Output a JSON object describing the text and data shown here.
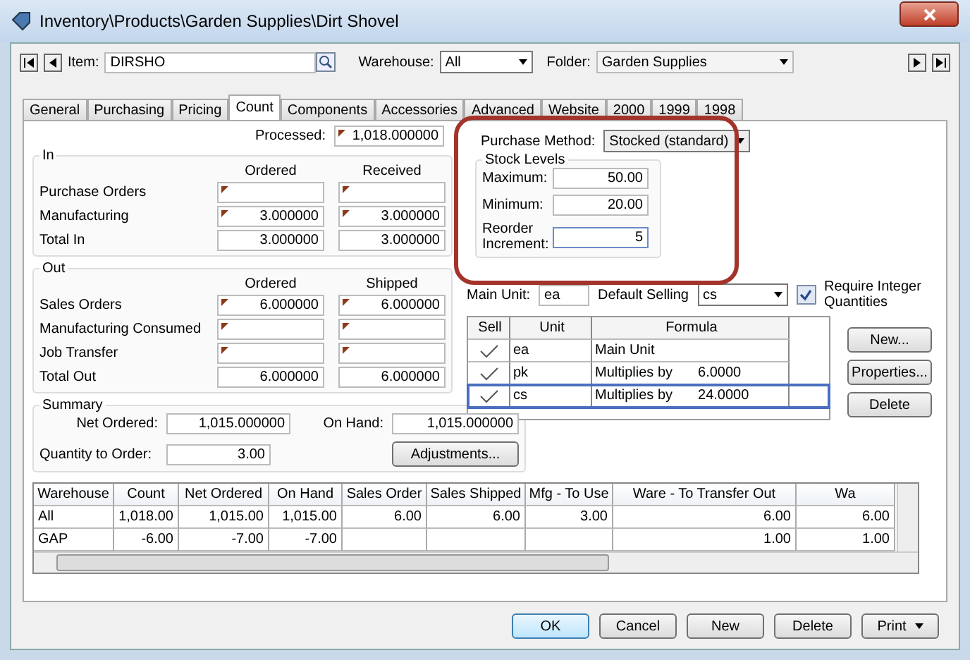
{
  "window": {
    "title": "Inventory\\Products\\Garden Supplies\\Dirt Shovel"
  },
  "toolbar": {
    "item_label": "Item:",
    "item_value": "DIRSHO",
    "warehouse_label": "Warehouse:",
    "warehouse_value": "All",
    "folder_label": "Folder:",
    "folder_value": "Garden Supplies"
  },
  "tabs": [
    {
      "label": "General",
      "selected": false
    },
    {
      "label": "Purchasing",
      "selected": false
    },
    {
      "label": "Pricing",
      "selected": false
    },
    {
      "label": "Count",
      "selected": true
    },
    {
      "label": "Components",
      "selected": false
    },
    {
      "label": "Accessories",
      "selected": false
    },
    {
      "label": "Advanced",
      "selected": false
    },
    {
      "label": "Website",
      "selected": false
    },
    {
      "label": "2000",
      "selected": false
    },
    {
      "label": "1999",
      "selected": false
    },
    {
      "label": "1998",
      "selected": false
    }
  ],
  "processed": {
    "label": "Processed:",
    "value": "1,018.000000",
    "flagged": true
  },
  "in_group": {
    "title": "In",
    "columns": [
      "Ordered",
      "Received"
    ],
    "rows": [
      {
        "label": "Purchase Orders",
        "cells": [
          {
            "flagged": true
          },
          {
            "flagged": true
          }
        ]
      },
      {
        "label": "Manufacturing",
        "cells": [
          {
            "value": "3.000000",
            "flagged": true
          },
          {
            "value": "3.000000",
            "flagged": true
          }
        ]
      },
      {
        "label": "Total In",
        "cells": [
          {
            "value": "3.000000",
            "flagged": false
          },
          {
            "value": "3.000000",
            "flagged": false
          }
        ]
      }
    ]
  },
  "out_group": {
    "title": "Out",
    "columns": [
      "Ordered",
      "Shipped"
    ],
    "rows": [
      {
        "label": "Sales Orders",
        "cells": [
          {
            "value": "6.000000",
            "flagged": true
          },
          {
            "value": "6.000000",
            "flagged": true
          }
        ]
      },
      {
        "label": "Manufacturing Consumed",
        "cells": [
          {
            "flagged": true
          },
          {
            "flagged": true
          }
        ]
      },
      {
        "label": "Job Transfer",
        "cells": [
          {
            "flagged": true
          },
          {
            "flagged": true
          }
        ]
      },
      {
        "label": "Total Out",
        "cells": [
          {
            "value": "6.000000",
            "flagged": false
          },
          {
            "value": "6.000000",
            "flagged": false
          }
        ]
      }
    ]
  },
  "summary": {
    "title": "Summary",
    "net_ordered_label": "Net Ordered:",
    "net_ordered": "1,015.000000",
    "on_hand_label": "On Hand:",
    "on_hand": "1,015.000000",
    "quantity_label": "Quantity to Order:",
    "quantity": "3.00",
    "adjustments_button": "Adjustments..."
  },
  "purchase_method": {
    "label": "Purchase Method:",
    "value": "Stocked (standard)"
  },
  "stock_levels": {
    "title": "Stock Levels",
    "rows": [
      {
        "label": "Maximum:",
        "value": "50.00",
        "focused": false
      },
      {
        "label": "Minimum:",
        "value": "20.00",
        "focused": false
      },
      {
        "label": "Reorder Increment:",
        "value": "5",
        "focused": true
      }
    ]
  },
  "units": {
    "main_unit_label": "Main Unit:",
    "main_unit_value": "ea",
    "default_selling_label": "Default Selling",
    "default_selling_value": "cs",
    "require_integer": {
      "label": "Require Integer Quantities",
      "checked": true
    },
    "columns": [
      "Sell",
      "Unit",
      "Formula"
    ],
    "rows": [
      {
        "sell": true,
        "unit": "ea",
        "formula": "Main Unit",
        "selected": false
      },
      {
        "sell": true,
        "unit": "pk",
        "formula": "Multiplies by",
        "factor": "6.0000",
        "selected": false
      },
      {
        "sell": true,
        "unit": "cs",
        "formula": "Multiplies by",
        "factor": "24.0000",
        "selected": true
      }
    ],
    "buttons": [
      "New...",
      "Properties...",
      "Delete"
    ]
  },
  "grid": {
    "columns": [
      "Warehouse",
      "Count",
      "Net Ordered",
      "On Hand",
      "Sales Order",
      "Sales Shipped",
      "Mfg - To Use",
      "Ware - To Transfer Out",
      "Wa"
    ],
    "rows": [
      [
        "All",
        "1,018.00",
        "1,015.00",
        "1,015.00",
        "6.00",
        "6.00",
        "3.00",
        "6.00",
        "6.00"
      ],
      [
        "GAP",
        "-6.00",
        "-7.00",
        "-7.00",
        null,
        null,
        null,
        "1.00",
        "1.00"
      ]
    ]
  },
  "buttons": [
    {
      "label": "OK",
      "kind": "default"
    },
    {
      "label": "Cancel",
      "kind": "plain"
    },
    {
      "label": "New",
      "kind": "plain"
    },
    {
      "label": "Delete",
      "kind": "plain"
    },
    {
      "label": "Print",
      "kind": "dropdown"
    }
  ]
}
